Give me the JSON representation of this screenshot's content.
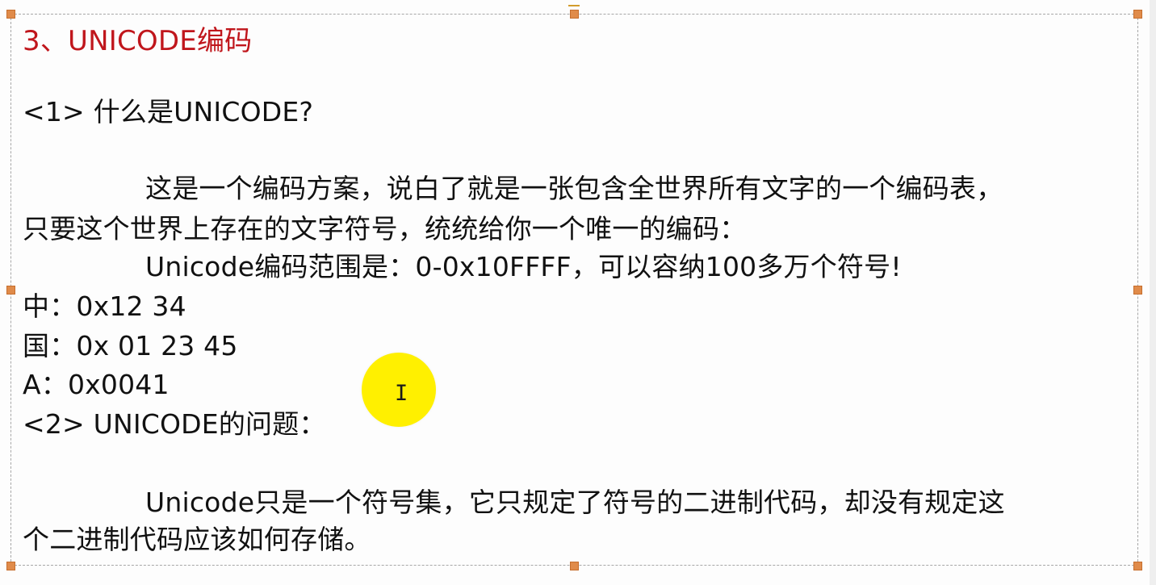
{
  "slide": {
    "title": "3、UNICODE编码",
    "section1_heading": "<1> 什么是UNICODE?",
    "para1_line1": "这是一个编码方案，说白了就是一张包含全世界所有文字的一个编码表，",
    "para1_line2": "只要这个世界上存在的文字符号，统统给你一个唯一的编码：",
    "para1_line3": "Unicode编码范围是：0-0x10FFFF，可以容纳100多万个符号!",
    "example1": "中：0x12 34",
    "example2": "国：0x 01 23 45",
    "example3": "A：0x0041",
    "section2_heading": "<2> UNICODE的问题：",
    "para2_line1": "Unicode只是一个符号集，它只规定了符号的二进制代码，却没有规定这",
    "para2_line2": "个二进制代码应该如何存储。"
  },
  "colors": {
    "title": "#c0161c",
    "handle": "#e08b4a",
    "highlight": "#fff000"
  },
  "icons": {
    "cursor": "text-cursor-icon"
  }
}
